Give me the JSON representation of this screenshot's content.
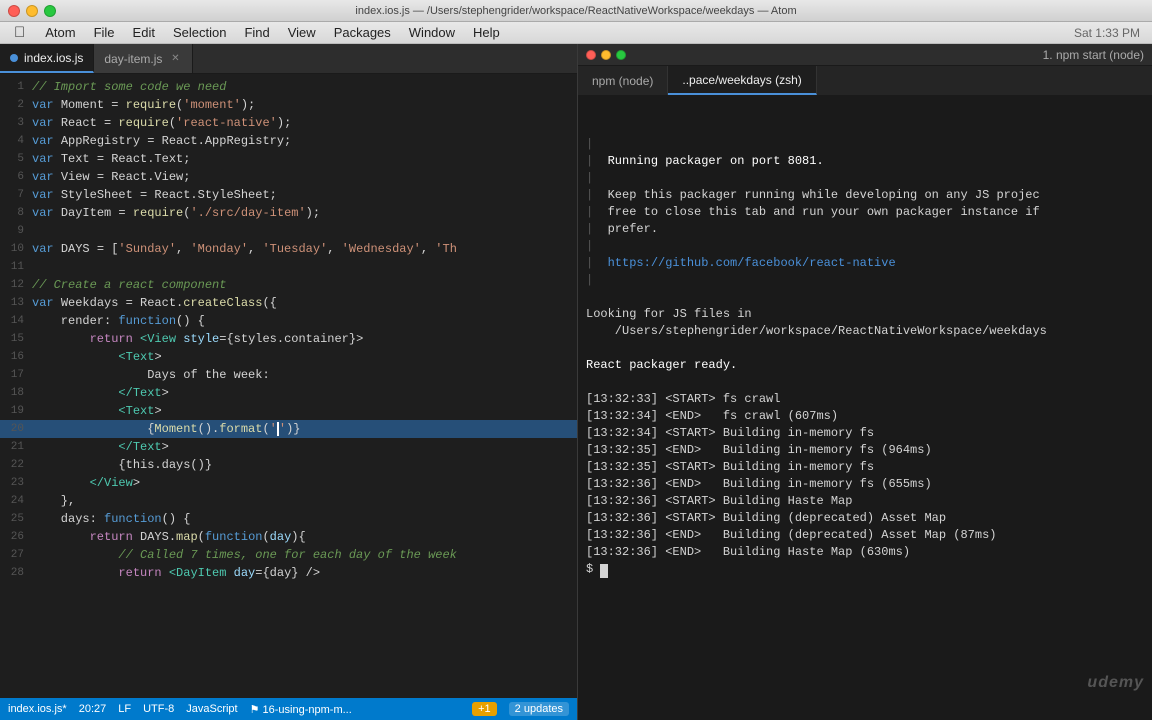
{
  "titleBar": {
    "title": "index.ios.js — /Users/stephengrider/workspace/ReactNativeWorkspace/weekdays — Atom"
  },
  "menuBar": {
    "items": [
      "",
      "Atom",
      "File",
      "Edit",
      "Selection",
      "Find",
      "View",
      "Packages",
      "Window",
      "Help"
    ]
  },
  "tabs": [
    {
      "name": "index.ios.js",
      "active": true,
      "modified": true,
      "showClose": false
    },
    {
      "name": "day-item.js",
      "active": false,
      "modified": false,
      "showClose": true
    }
  ],
  "codeLines": [
    {
      "num": 1,
      "tokens": [
        {
          "t": "comment",
          "v": "// Import some code we need"
        }
      ]
    },
    {
      "num": 2,
      "tokens": [
        {
          "t": "varkw",
          "v": "var "
        },
        {
          "t": "plain",
          "v": "Moment = "
        },
        {
          "t": "func",
          "v": "require"
        },
        {
          "t": "plain",
          "v": "("
        },
        {
          "t": "string",
          "v": "'moment'"
        },
        {
          "t": "plain",
          "v": ");"
        }
      ]
    },
    {
      "num": 3,
      "tokens": [
        {
          "t": "varkw",
          "v": "var "
        },
        {
          "t": "plain",
          "v": "React = "
        },
        {
          "t": "func",
          "v": "require"
        },
        {
          "t": "plain",
          "v": "("
        },
        {
          "t": "string",
          "v": "'react-native'"
        },
        {
          "t": "plain",
          "v": ");"
        }
      ]
    },
    {
      "num": 4,
      "tokens": [
        {
          "t": "varkw",
          "v": "var "
        },
        {
          "t": "plain",
          "v": "AppRegistry = React.AppRegistry;"
        }
      ]
    },
    {
      "num": 5,
      "tokens": [
        {
          "t": "varkw",
          "v": "var "
        },
        {
          "t": "plain",
          "v": "Text = React.Text;"
        }
      ]
    },
    {
      "num": 6,
      "tokens": [
        {
          "t": "varkw",
          "v": "var "
        },
        {
          "t": "plain",
          "v": "View = React.View;"
        }
      ]
    },
    {
      "num": 7,
      "tokens": [
        {
          "t": "varkw",
          "v": "var "
        },
        {
          "t": "plain",
          "v": "StyleSheet = React.StyleSheet;"
        }
      ]
    },
    {
      "num": 8,
      "tokens": [
        {
          "t": "varkw",
          "v": "var "
        },
        {
          "t": "plain",
          "v": "DayItem = "
        },
        {
          "t": "func",
          "v": "require"
        },
        {
          "t": "plain",
          "v": "("
        },
        {
          "t": "string",
          "v": "'./src/day-item'"
        },
        {
          "t": "plain",
          "v": ");"
        }
      ]
    },
    {
      "num": 9,
      "tokens": []
    },
    {
      "num": 10,
      "tokens": [
        {
          "t": "varkw",
          "v": "var "
        },
        {
          "t": "plain",
          "v": "DAYS = ["
        },
        {
          "t": "string",
          "v": "'Sunday'"
        },
        {
          "t": "plain",
          "v": ", "
        },
        {
          "t": "string",
          "v": "'Monday'"
        },
        {
          "t": "plain",
          "v": ", "
        },
        {
          "t": "string",
          "v": "'Tuesday'"
        },
        {
          "t": "plain",
          "v": ", "
        },
        {
          "t": "string",
          "v": "'Wednesday'"
        },
        {
          "t": "plain",
          "v": ", "
        },
        {
          "t": "string",
          "v": "'Th"
        }
      ]
    },
    {
      "num": 11,
      "tokens": []
    },
    {
      "num": 12,
      "tokens": [
        {
          "t": "comment",
          "v": "// Create a react component"
        }
      ]
    },
    {
      "num": 13,
      "tokens": [
        {
          "t": "varkw",
          "v": "var "
        },
        {
          "t": "plain",
          "v": "Weekdays = React."
        },
        {
          "t": "func",
          "v": "createClass"
        },
        {
          "t": "plain",
          "v": "({"
        }
      ]
    },
    {
      "num": 14,
      "tokens": [
        {
          "t": "plain",
          "v": "    render: "
        },
        {
          "t": "varkw",
          "v": "function"
        },
        {
          "t": "plain",
          "v": "() {"
        }
      ]
    },
    {
      "num": 15,
      "tokens": [
        {
          "t": "plain",
          "v": "        "
        },
        {
          "t": "kw",
          "v": "return"
        },
        {
          "t": "plain",
          "v": " "
        },
        {
          "t": "tag",
          "v": "<View"
        },
        {
          "t": "plain",
          "v": " "
        },
        {
          "t": "attr",
          "v": "style"
        },
        {
          "t": "plain",
          "v": "={styles.container}>"
        }
      ]
    },
    {
      "num": 16,
      "tokens": [
        {
          "t": "plain",
          "v": "            "
        },
        {
          "t": "tag",
          "v": "<Text"
        },
        {
          "t": "plain",
          "v": ">"
        }
      ]
    },
    {
      "num": 17,
      "tokens": [
        {
          "t": "plain",
          "v": "                Days of the week:"
        }
      ]
    },
    {
      "num": 18,
      "tokens": [
        {
          "t": "plain",
          "v": "            "
        },
        {
          "t": "tag",
          "v": "</Text"
        },
        {
          "t": "plain",
          "v": ">"
        }
      ]
    },
    {
      "num": 19,
      "tokens": [
        {
          "t": "plain",
          "v": "            "
        },
        {
          "t": "tag",
          "v": "<Text"
        },
        {
          "t": "plain",
          "v": ">"
        }
      ]
    },
    {
      "num": 20,
      "tokens": [
        {
          "t": "plain",
          "v": "                {"
        },
        {
          "t": "func",
          "v": "Moment"
        },
        {
          "t": "plain",
          "v": "()."
        },
        {
          "t": "func",
          "v": "format"
        },
        {
          "t": "plain",
          "v": "("
        },
        {
          "t": "string",
          "v": "'"
        },
        {
          "t": "cursor",
          "v": ""
        },
        {
          "t": "string",
          "v": "'"
        },
        {
          "t": "plain",
          "v": ")}"
        }
      ],
      "highlighted": true
    },
    {
      "num": 21,
      "tokens": [
        {
          "t": "plain",
          "v": "            "
        },
        {
          "t": "tag",
          "v": "</Text"
        },
        {
          "t": "plain",
          "v": ">"
        }
      ]
    },
    {
      "num": 22,
      "tokens": [
        {
          "t": "plain",
          "v": "            {this.days()}"
        }
      ]
    },
    {
      "num": 23,
      "tokens": [
        {
          "t": "plain",
          "v": "        "
        },
        {
          "t": "tag",
          "v": "</View"
        },
        {
          "t": "plain",
          "v": ">"
        }
      ]
    },
    {
      "num": 24,
      "tokens": [
        {
          "t": "plain",
          "v": "    },"
        }
      ]
    },
    {
      "num": 25,
      "tokens": [
        {
          "t": "plain",
          "v": "    days: "
        },
        {
          "t": "varkw",
          "v": "function"
        },
        {
          "t": "plain",
          "v": "() {"
        }
      ]
    },
    {
      "num": 26,
      "tokens": [
        {
          "t": "plain",
          "v": "        "
        },
        {
          "t": "kw",
          "v": "return"
        },
        {
          "t": "plain",
          "v": " DAYS."
        },
        {
          "t": "func",
          "v": "map"
        },
        {
          "t": "plain",
          "v": "("
        },
        {
          "t": "varkw",
          "v": "function"
        },
        {
          "t": "plain",
          "v": "("
        },
        {
          "t": "blue",
          "v": "day"
        },
        {
          "t": "plain",
          "v": "){"
        }
      ]
    },
    {
      "num": 27,
      "tokens": [
        {
          "t": "comment",
          "v": "            // Called 7 times, one for each day of the week"
        }
      ]
    },
    {
      "num": 28,
      "tokens": [
        {
          "t": "plain",
          "v": "            "
        },
        {
          "t": "kw",
          "v": "return"
        },
        {
          "t": "plain",
          "v": " "
        },
        {
          "t": "tag",
          "v": "<DayItem"
        },
        {
          "t": "plain",
          "v": " "
        },
        {
          "t": "attr",
          "v": "day"
        },
        {
          "t": "plain",
          "v": "={day} />"
        }
      ]
    }
  ],
  "statusBar": {
    "filename": "index.ios.js*",
    "position": "20:27",
    "lineEnding": "LF",
    "encoding": "UTF-8",
    "language": "JavaScript",
    "jsHint": "⚑ 16-using-npm-m...",
    "bell": "+1",
    "updates": "2 updates"
  },
  "terminal": {
    "windowTitle": "1. npm start (node)",
    "tabs": [
      {
        "name": "npm (node)",
        "active": false
      },
      {
        "name": "..pace/weekdays (zsh)",
        "active": true
      }
    ],
    "lines": [
      "",
      "",
      "|",
      "|  Running packager on port 8081.",
      "|",
      "|  Keep this packager running while developing on any JS projec",
      "|  free to close this tab and run your own packager instance if",
      "|  prefer.",
      "|",
      "|  https://github.com/facebook/react-native",
      "|",
      "",
      "Looking for JS files in",
      "    /Users/stephengrider/workspace/ReactNativeWorkspace/weekdays",
      "",
      "React packager ready.",
      "",
      "[13:32:33] <START> fs crawl",
      "[13:32:34] <END>   fs crawl (607ms)",
      "[13:32:34] <START> Building in-memory fs",
      "[13:32:35] <END>   Building in-memory fs (964ms)",
      "[13:32:35] <START> Building in-memory fs",
      "[13:32:36] <END>   Building in-memory fs (655ms)",
      "[13:32:36] <START> Building Haste Map",
      "[13:32:36] <START> Building (deprecated) Asset Map",
      "[13:32:36] <END>   Building (deprecated) Asset Map (87ms)",
      "[13:32:36] <END>   Building Haste Map (630ms)",
      "$"
    ]
  }
}
